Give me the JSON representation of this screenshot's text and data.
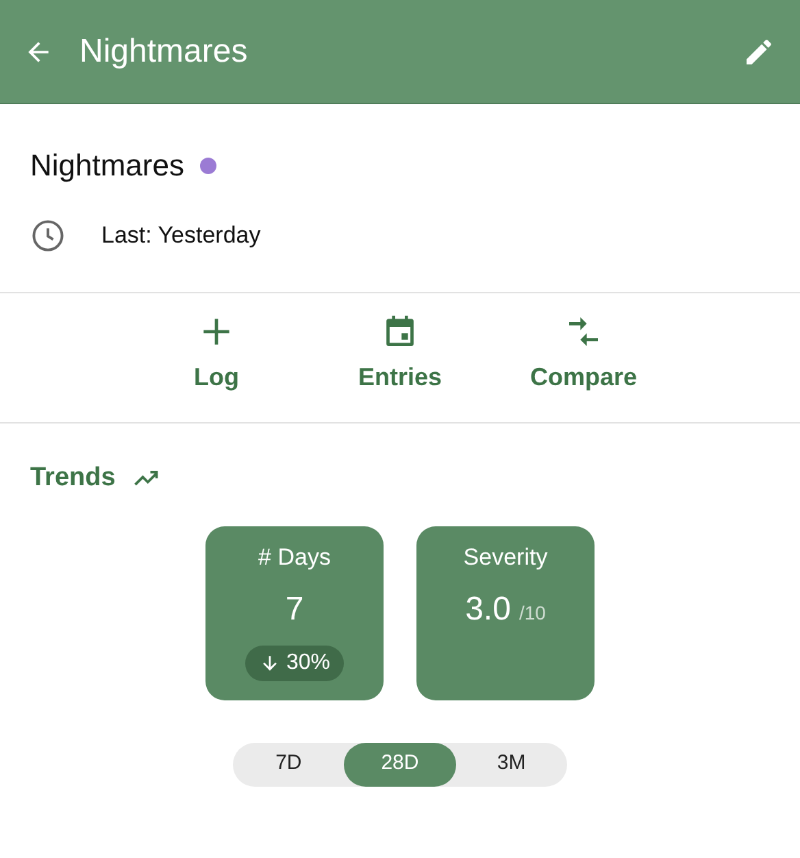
{
  "app_bar": {
    "title": "Nightmares"
  },
  "header": {
    "name": "Nightmares",
    "color": "#9b7bd4",
    "last": "Last: Yesterday"
  },
  "actions": [
    {
      "kind": "plus",
      "label": "Log"
    },
    {
      "kind": "calendar",
      "label": "Entries"
    },
    {
      "kind": "compare",
      "label": "Compare"
    }
  ],
  "trends": {
    "title": "Trends",
    "stats": [
      {
        "label": "# Days",
        "value": "7",
        "change": {
          "kind": "down",
          "text": "30%"
        }
      },
      {
        "label": "Severity",
        "value": "3.0",
        "unit": "/10"
      }
    ],
    "ranges": [
      {
        "label": "7D",
        "selected": false
      },
      {
        "label": "28D",
        "selected": true
      },
      {
        "label": "3M",
        "selected": false
      }
    ]
  }
}
